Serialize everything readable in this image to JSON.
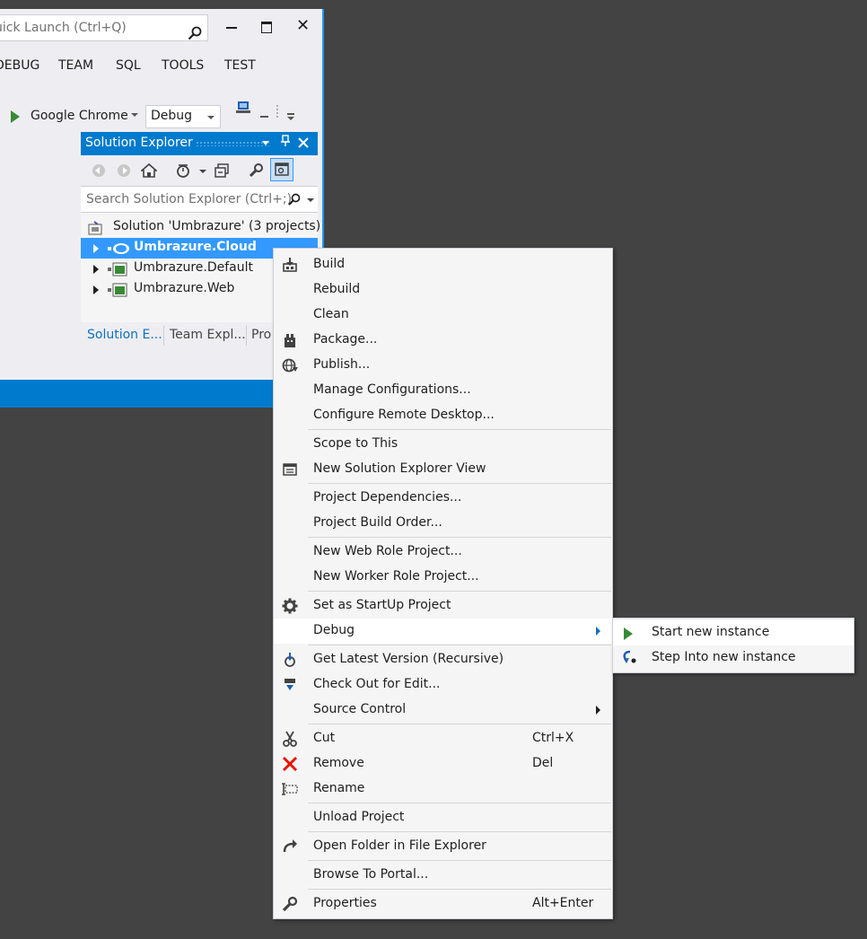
{
  "window": {
    "quick_launch": "Quick Launch (Ctrl+Q)",
    "close": "✕",
    "menu": [
      "DEBUG",
      "TEAM",
      "SQL",
      "TOOLS",
      "TEST"
    ],
    "run_target": "Google Chrome",
    "configuration": "Debug"
  },
  "solution_explorer": {
    "title": "Solution Explorer",
    "search_placeholder": "Search Solution Explorer (Ctrl+;)",
    "solution": "Solution 'Umbrazure' (3 projects)",
    "projects": [
      "Umbrazure.Cloud",
      "Umbrazure.Default",
      "Umbrazure.Web"
    ],
    "tabs": [
      "Solution E...",
      "Team Expl...",
      "Pro"
    ]
  },
  "context_menu": {
    "items": [
      {
        "label": "Build",
        "icon": "build-icon"
      },
      {
        "label": "Rebuild"
      },
      {
        "label": "Clean"
      },
      {
        "label": "Package...",
        "icon": "package-icon"
      },
      {
        "label": "Publish...",
        "icon": "publish-icon"
      },
      {
        "label": "Manage Configurations..."
      },
      {
        "label": "Configure Remote Desktop..."
      },
      {
        "label": "Scope to This"
      },
      {
        "label": "New Solution Explorer View",
        "icon": "new-view-icon"
      },
      {
        "label": "Project Dependencies..."
      },
      {
        "label": "Project Build Order..."
      },
      {
        "label": "New Web Role Project..."
      },
      {
        "label": "New Worker Role Project..."
      },
      {
        "label": "Set as StartUp Project",
        "icon": "gear-icon"
      },
      {
        "label": "Debug",
        "submenu": true
      },
      {
        "label": "Get Latest Version (Recursive)",
        "icon": "get-latest-icon"
      },
      {
        "label": "Check Out for Edit...",
        "icon": "checkout-icon"
      },
      {
        "label": "Source Control",
        "submenu": true
      },
      {
        "label": "Cut",
        "shortcut": "Ctrl+X",
        "icon": "scissors-icon"
      },
      {
        "label": "Remove",
        "shortcut": "Del",
        "icon": "remove-x-icon"
      },
      {
        "label": "Rename",
        "icon": "rename-icon"
      },
      {
        "label": "Unload Project"
      },
      {
        "label": "Open Folder in File Explorer",
        "icon": "open-folder-arrow-icon"
      },
      {
        "label": "Browse To Portal..."
      },
      {
        "label": "Properties",
        "shortcut": "Alt+Enter",
        "icon": "wrench-icon"
      }
    ]
  },
  "debug_submenu": {
    "items": [
      "Start new instance",
      "Step Into new instance"
    ]
  },
  "colors": {
    "accent": "#007acc",
    "selection": "#3399ff",
    "background": "#434343",
    "remove_icon": "#e51400",
    "play_icon": "#388a34"
  }
}
